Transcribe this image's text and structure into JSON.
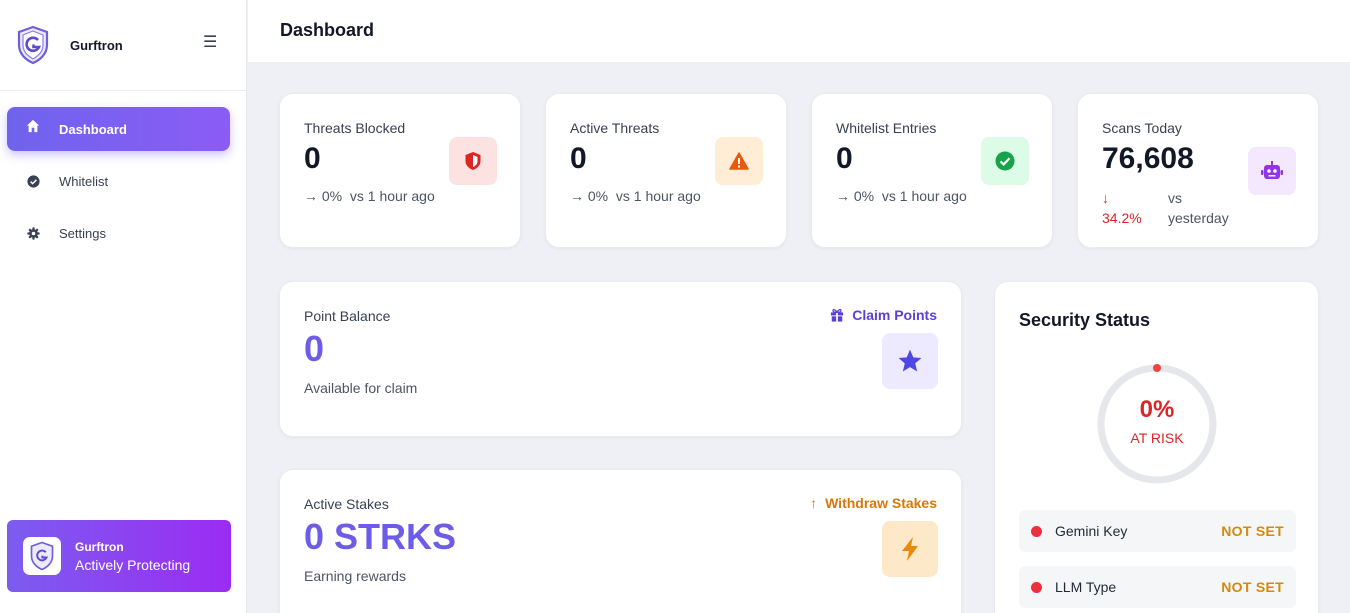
{
  "app": {
    "name": "Gurftron"
  },
  "sidebar": {
    "items": [
      {
        "label": "Dashboard",
        "icon": "home-icon",
        "active": true
      },
      {
        "label": "Whitelist",
        "icon": "check-circle-icon",
        "active": false
      },
      {
        "label": "Settings",
        "icon": "gear-icon",
        "active": false
      }
    ],
    "status_card": {
      "name": "Gurftron",
      "status": "Actively Protecting"
    }
  },
  "header": {
    "title": "Dashboard"
  },
  "stats": [
    {
      "label": "Threats Blocked",
      "value": "0",
      "trend": "→ 0%",
      "compare": "vs 1 hour ago",
      "icon": "shield-icon",
      "icon_color": "#dc2626",
      "icon_bg": "#fde2e2"
    },
    {
      "label": "Active Threats",
      "value": "0",
      "trend": "→ 0%",
      "compare": "vs 1 hour ago",
      "icon": "warning-triangle-icon",
      "icon_color": "#ea580c",
      "icon_bg": "#ffedd5"
    },
    {
      "label": "Whitelist Entries",
      "value": "0",
      "trend": "→ 0%",
      "compare": "vs 1 hour ago",
      "icon": "check-circle-icon",
      "icon_color": "#16a34a",
      "icon_bg": "#dcfce7"
    },
    {
      "label": "Scans Today",
      "value": "76,608",
      "trend_arrow": "↓",
      "trend": "34.2%",
      "compare_line1": "vs",
      "compare_line2": "yesterday",
      "icon": "robot-icon",
      "icon_color": "#9333ea",
      "icon_bg": "#f3e8ff"
    }
  ],
  "points": {
    "label": "Point Balance",
    "value": "0",
    "sub": "Available for claim",
    "action": "Claim Points",
    "action_icon": "gift-icon",
    "action_color": "#5b3fd9",
    "icon": "star-icon"
  },
  "stakes": {
    "label": "Active Stakes",
    "value": "0 STRKS",
    "sub": "Earning rewards",
    "action": "Withdraw Stakes",
    "action_arrow": "↑",
    "action_color": "#d97706",
    "icon": "bolt-icon"
  },
  "security": {
    "title": "Security Status",
    "percent": "0%",
    "percent_value": 0,
    "status": "AT RISK",
    "items": [
      {
        "name": "Gemini Key",
        "value": "NOT SET"
      },
      {
        "name": "LLM Type",
        "value": "NOT SET"
      }
    ]
  },
  "colors": {
    "accent": "#6c5ce7",
    "danger": "#dc2626",
    "warning": "#d4890a"
  }
}
